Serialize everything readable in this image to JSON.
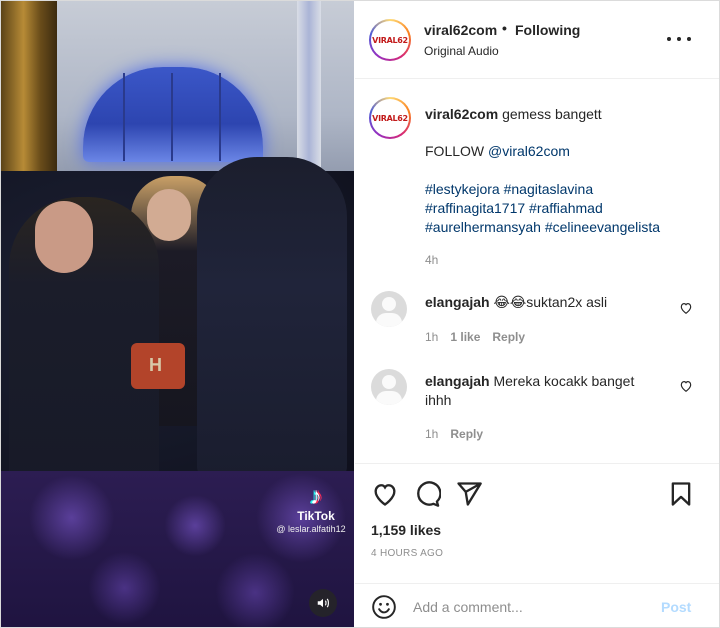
{
  "media": {
    "watermark_brand": "TikTok",
    "watermark_handle": "@ leslar.alfatih12",
    "sound_icon": "speaker-icon"
  },
  "header": {
    "avatar_text": "VIRAL62",
    "username": "viral62com",
    "separator": "•",
    "follow_status": "Following",
    "audio": "Original Audio",
    "more_icon": "more-options-icon"
  },
  "caption": {
    "avatar_text": "VIRAL62",
    "username": "viral62com",
    "text": "gemess bangett",
    "follow_prefix": "FOLLOW ",
    "follow_mention": "@viral62com",
    "hashtags_line1": "#lestykejora #nagitaslavina",
    "hashtags_line2": "#raffinagita1717 #raffiahmad",
    "hashtags_line3": "#aurelhermansyah #celineevangelista",
    "time": "4h"
  },
  "comments": [
    {
      "username": "elangajah",
      "text": "😂😂suktan2x asli",
      "time": "1h",
      "likes": "1 like",
      "reply": "Reply"
    },
    {
      "username": "elangajah",
      "text_line1": "Mereka kocakk banget",
      "text_line2": "ihhh",
      "time": "1h",
      "reply": "Reply"
    }
  ],
  "actions": {
    "likes": "1,159 likes",
    "posted": "4 HOURS AGO"
  },
  "comment_bar": {
    "placeholder": "Add a comment...",
    "post_label": "Post"
  },
  "colors": {
    "link": "#00376b",
    "muted": "#8e8e8e",
    "post_disabled": "#b3dbff",
    "text": "#262626"
  }
}
